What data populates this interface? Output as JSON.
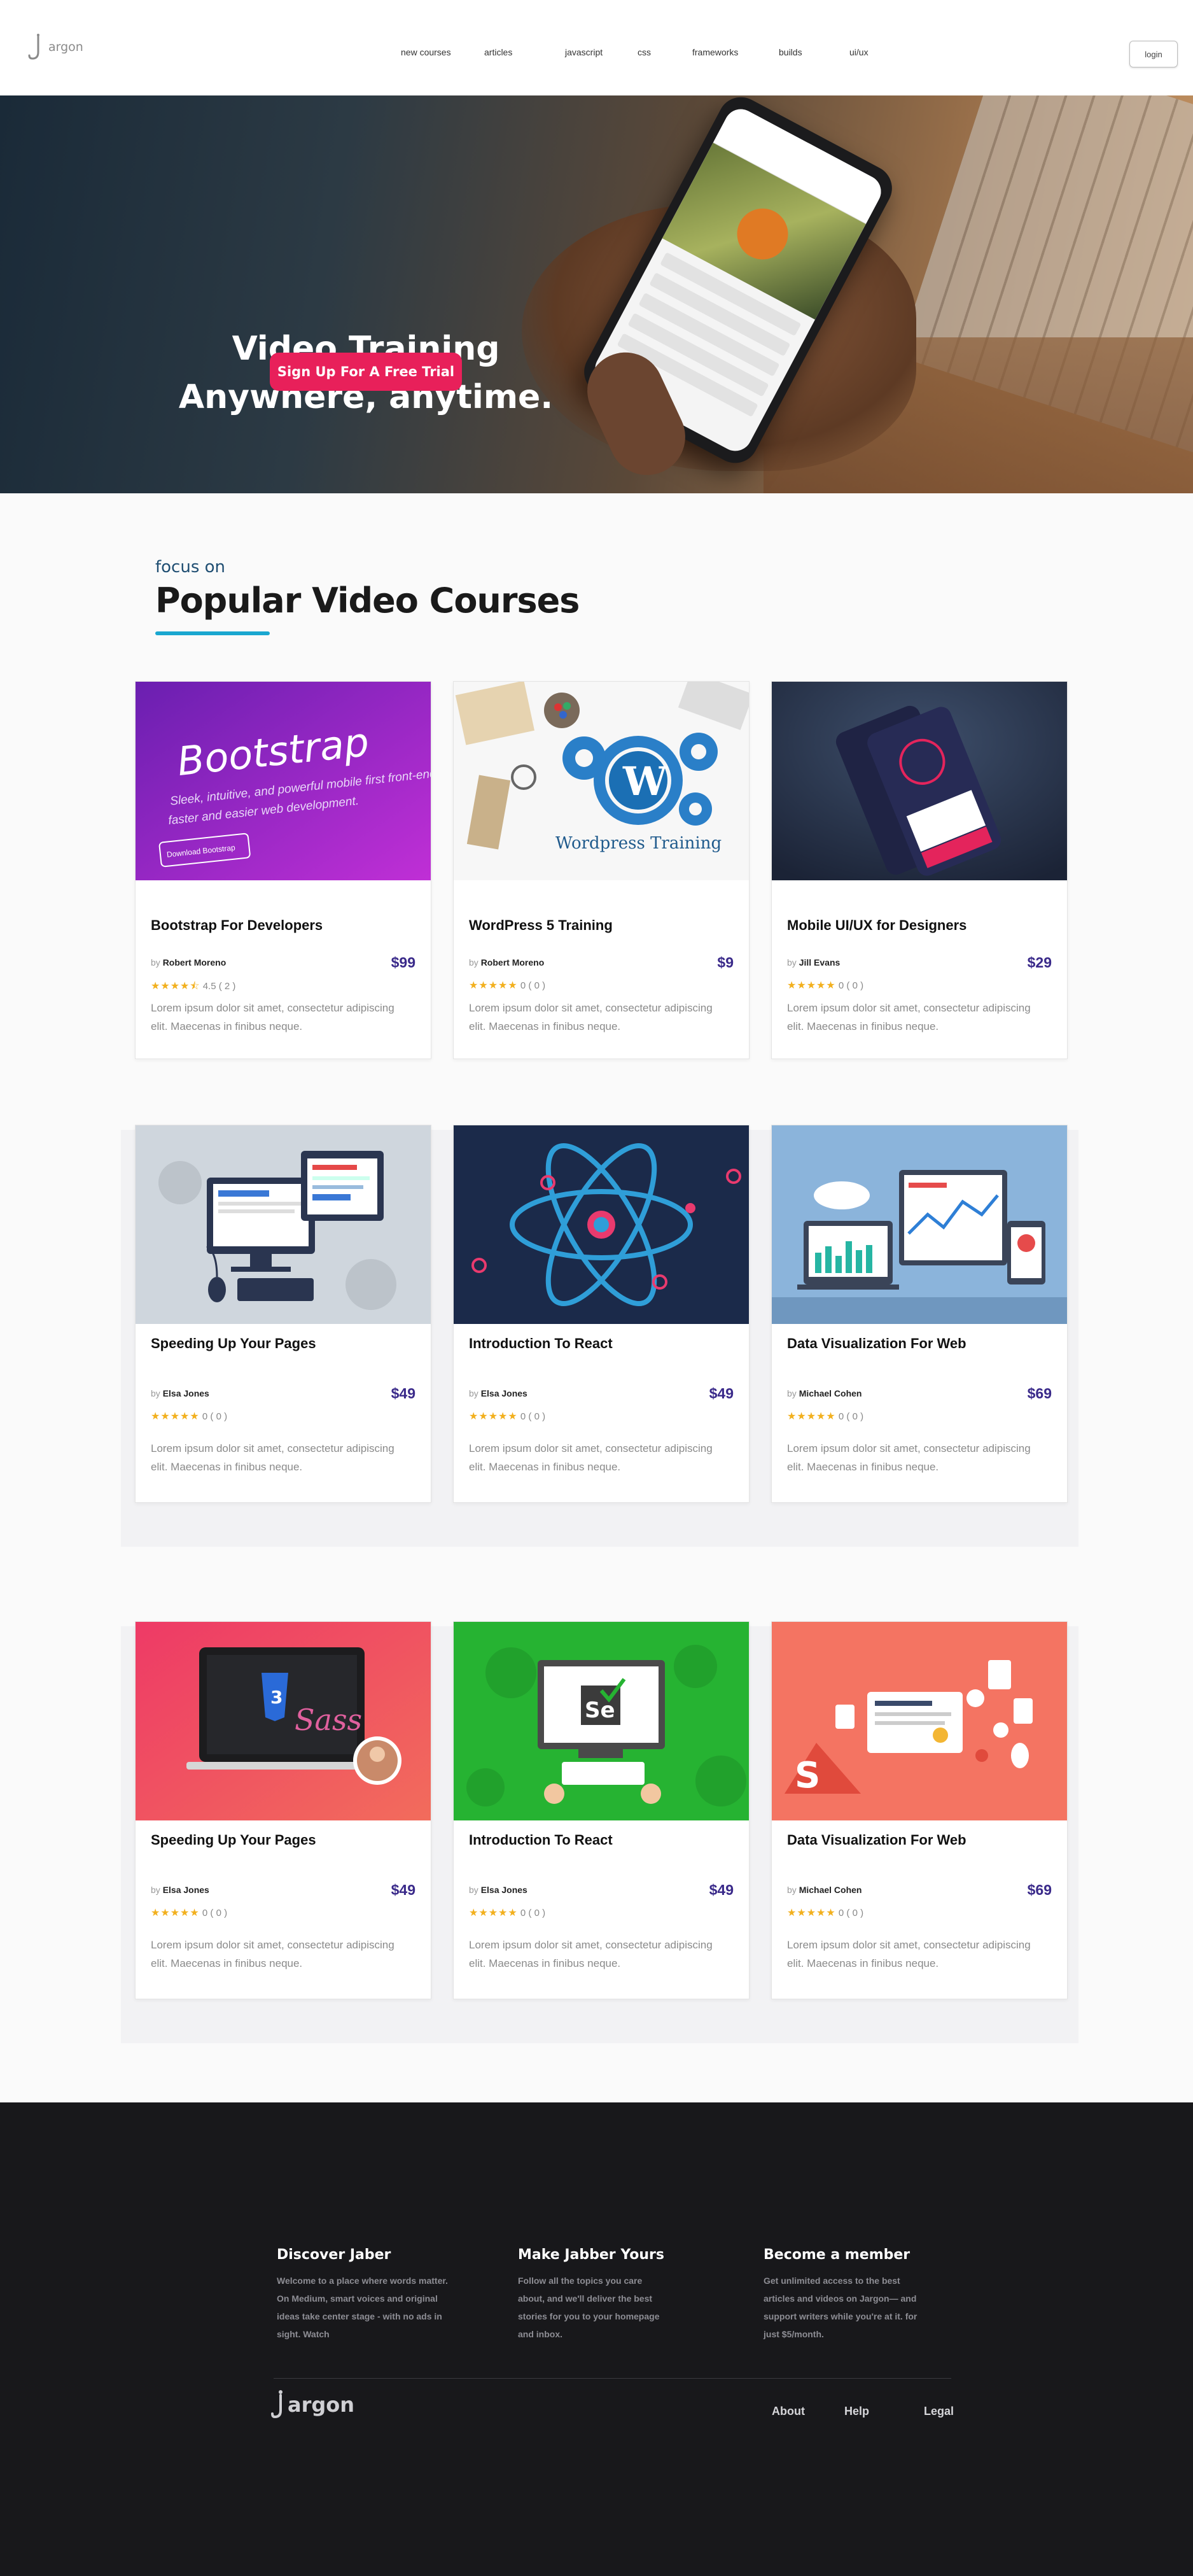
{
  "brand": {
    "logo_text": "argon"
  },
  "nav": {
    "links": [
      "new courses",
      "articles",
      "javascript",
      "css",
      "frameworks",
      "builds",
      "ui/ux"
    ],
    "login_label": "login"
  },
  "hero": {
    "title_line1": "Video Training",
    "title_line2": "Anywhere, anytime.",
    "cta_label": "Sign Up For A Free Trial"
  },
  "section": {
    "eyebrow": "focus on",
    "title": "Popular Video Courses"
  },
  "courses": [
    {
      "title": "Bootstrap For Developers",
      "by": "by",
      "author": "Robert Moreno",
      "price": "$99",
      "stars": "★★★★⯪",
      "rating_text": "4.5 ( 2 )",
      "desc": "Lorem ipsum dolor sit amet, consectetur adipiscing elit. Maecenas in finibus neque.",
      "image": "bootstrap",
      "image_text_main": "Bootstrap",
      "image_text_sub1": "Sleek, intuitive, and powerful mobile first front-end",
      "image_text_sub2": "faster and easier web development.",
      "image_button": "Download Bootstrap"
    },
    {
      "title": "WordPress  5 Training",
      "by": "by",
      "author": "Robert Moreno",
      "price": "$9",
      "stars": "★★★★★",
      "rating_text": "0 ( 0 )",
      "desc": "Lorem ipsum dolor sit amet, consectetur adipiscing elit. Maecenas in finibus neque.",
      "image": "wordpress",
      "image_text_main": "Wordpress  Training"
    },
    {
      "title": "Mobile UI/UX for Designers",
      "by": "by",
      "author": "Jill Evans",
      "price": "$29",
      "stars": "★★★★★",
      "rating_text": "0 ( 0 )",
      "desc": "Lorem ipsum dolor sit amet, consectetur adipiscing elit. Maecenas in finibus neque.",
      "image": "mobile"
    },
    {
      "title": "Speeding Up Your Pages",
      "by": "by",
      "author": "Elsa Jones",
      "price": "$49",
      "stars": "★★★★★",
      "rating_text": "0 ( 0 )",
      "desc": "Lorem ipsum dolor sit amet, consectetur adipiscing elit. Maecenas in finibus neque.",
      "image": "speed"
    },
    {
      "title": "Introduction To React",
      "by": "by",
      "author": "Elsa Jones",
      "price": "$49",
      "stars": "★★★★★",
      "rating_text": "0 ( 0 )",
      "desc": "Lorem ipsum dolor sit amet, consectetur adipiscing elit. Maecenas in finibus neque.",
      "image": "react"
    },
    {
      "title": "Data Visualization For Web",
      "by": "by",
      "author": "Michael Cohen",
      "price": "$69",
      "stars": "★★★★★",
      "rating_text": "0 ( 0 )",
      "desc": "Lorem ipsum dolor sit amet, consectetur adipiscing elit. Maecenas in finibus neque.",
      "image": "dataviz"
    },
    {
      "title": "Speeding Up Your Pages",
      "by": "by",
      "author": "Elsa Jones",
      "price": "$49",
      "stars": "★★★★★",
      "rating_text": "0 ( 0 )",
      "desc": "Lorem ipsum dolor sit amet, consectetur adipiscing elit. Maecenas in finibus neque.",
      "image": "sass",
      "image_text_main": "Sass"
    },
    {
      "title": "Introduction To React",
      "by": "by",
      "author": "Elsa Jones",
      "price": "$49",
      "stars": "★★★★★",
      "rating_text": "0 ( 0 )",
      "desc": "Lorem ipsum dolor sit amet, consectetur adipiscing elit. Maecenas in finibus neque.",
      "image": "selenium",
      "image_text_main": "Se"
    },
    {
      "title": "Data Visualization For Web",
      "by": "by",
      "author": "Michael Cohen",
      "price": "$69",
      "stars": "★★★★★",
      "rating_text": "0 ( 0 )",
      "desc": "Lorem ipsum dolor sit amet, consectetur adipiscing elit. Maecenas in finibus neque.",
      "image": "network"
    }
  ],
  "footer": {
    "columns": [
      {
        "title": "Discover Jaber",
        "text": "Welcome to a place where words matter. On Medium, smart voices and original ideas take center stage - with no ads in sight. Watch"
      },
      {
        "title": "Make Jabber Yours",
        "text": "Follow all the topics you care about, and we'll deliver the best stories for you to your homepage and inbox."
      },
      {
        "title": "Become a member",
        "text": "Get unlimited access to the best articles and videos on Jargon— and support writers while you're at it. for just $5/month."
      }
    ],
    "logo_text": "argon",
    "links": [
      "About",
      "Help",
      "Legal"
    ]
  },
  "colors": {
    "accent": "#e8205a",
    "price": "#3a2a8a",
    "heading_eyebrow": "#1f4e72",
    "underline": "#19a7d0",
    "footer_bg": "#18181b"
  }
}
